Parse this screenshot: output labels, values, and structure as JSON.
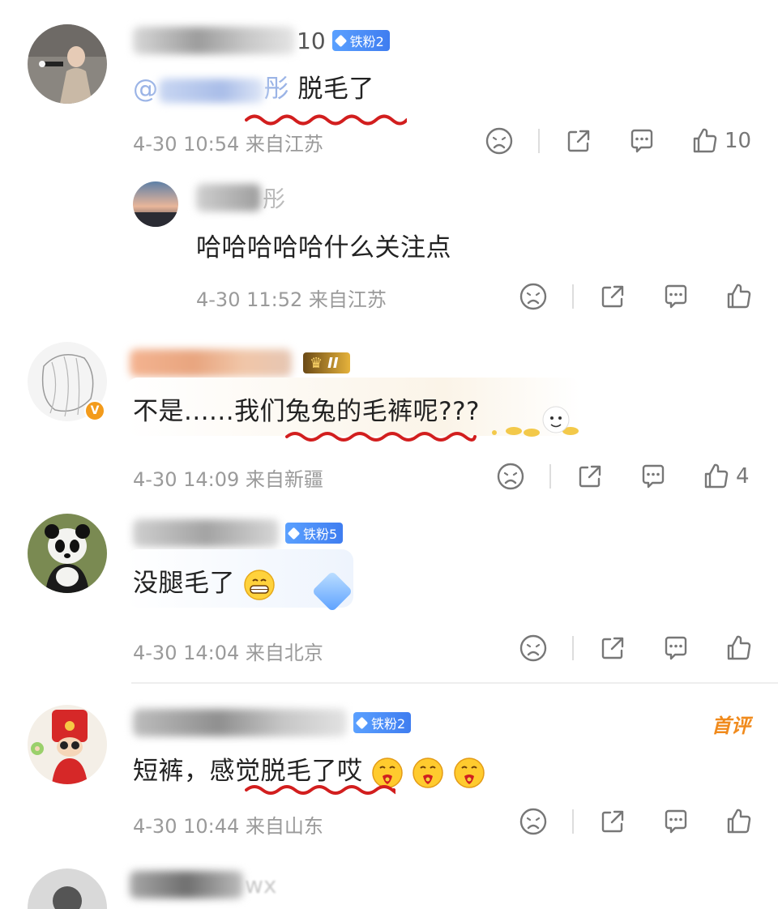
{
  "comments": [
    {
      "name_suffix": "10",
      "badge": "铁粉2",
      "mention_at": "@",
      "mention_tail": "彤",
      "text": "脱毛了",
      "time": "4-30 10:54",
      "location": "来自江苏",
      "likes": "10"
    },
    {
      "name_tail": "彤",
      "text": "哈哈哈哈哈什么关注点",
      "time": "4-30 11:52",
      "location": "来自江苏",
      "likes": ""
    },
    {
      "text": "不是......我们兔兔的毛裤呢???",
      "time": "4-30 14:09",
      "location": "来自新疆",
      "likes": "4",
      "level_badge": "II"
    },
    {
      "badge": "铁粉5",
      "text": "没腿毛了",
      "time": "4-30 14:04",
      "location": "来自北京",
      "likes": ""
    },
    {
      "badge": "铁粉2",
      "first_tag": "首评",
      "text": "短裤，感觉脱毛了哎",
      "time": "4-30 10:44",
      "location": "来自山东",
      "likes": ""
    },
    {
      "name_suffix": "wx"
    }
  ],
  "icons": {
    "dislike": "sad-face-icon",
    "share": "share-icon",
    "comment": "comment-icon",
    "like": "thumbs-up-icon"
  },
  "colors": {
    "accent_blue": "#3f7df0",
    "underline_red": "#d21e1e",
    "meta_gray": "#9a9a9a",
    "first_tag_orange": "#f08a1c"
  }
}
